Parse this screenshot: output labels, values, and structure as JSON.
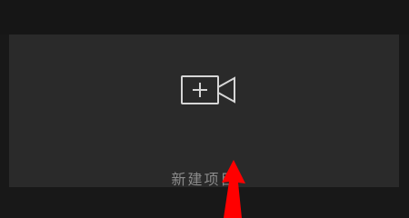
{
  "new_project": {
    "label": "新建项目",
    "icon": "add-video-icon"
  },
  "annotation": {
    "icon": "red-arrow-icon",
    "color": "#ff0000"
  },
  "colors": {
    "background": "#181818",
    "card": "#2a2a2a",
    "text": "#8b8b8b",
    "icon": "#d6d6d6"
  }
}
